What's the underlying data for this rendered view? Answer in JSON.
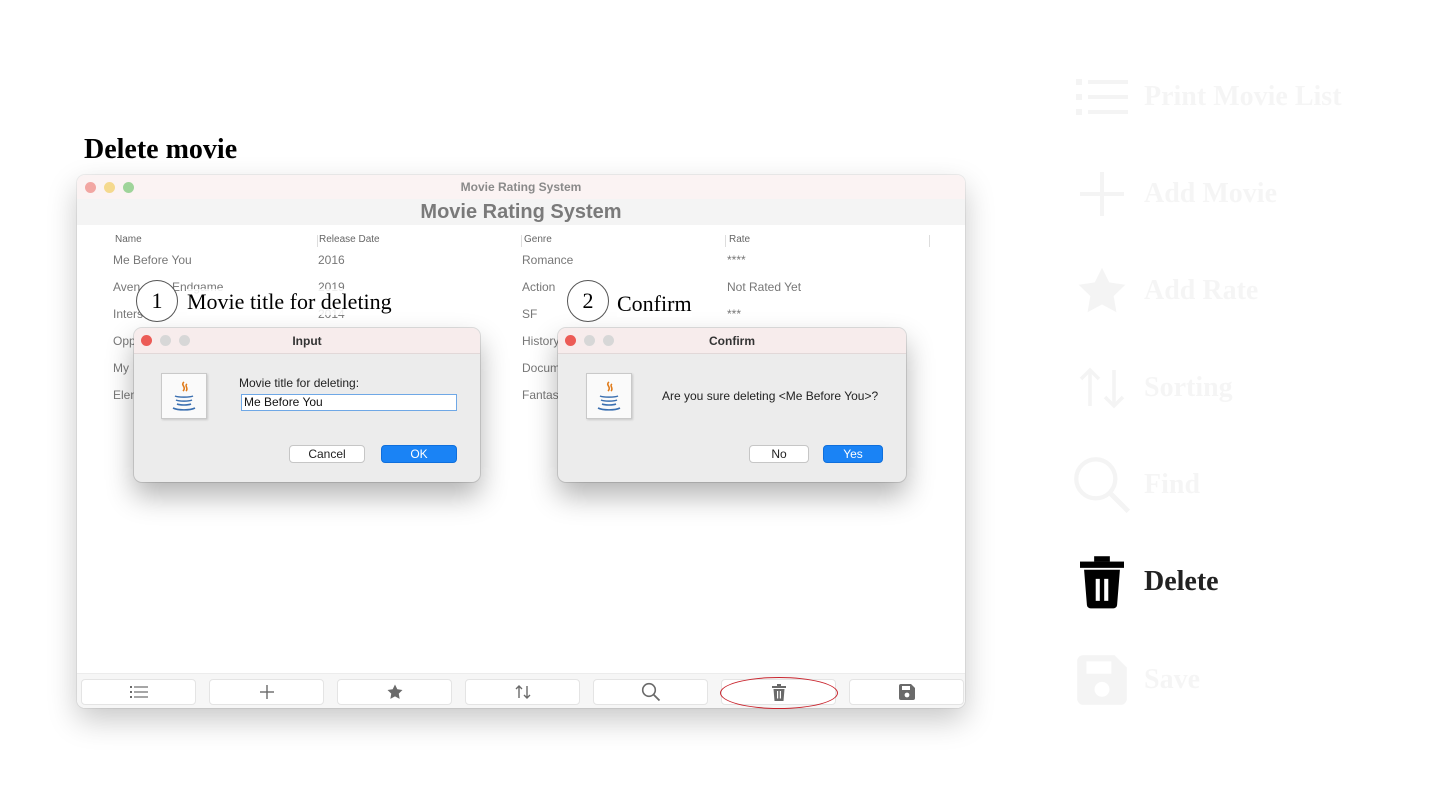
{
  "slide_title": "Delete movie",
  "window": {
    "title": "Movie Rating System",
    "app_title": "Movie Rating System",
    "columns": [
      "Name",
      "Release Date",
      "Genre",
      "Rate"
    ],
    "rows": [
      [
        "Me Before You",
        "2016",
        "Romance",
        "****"
      ],
      [
        "Aven",
        "2019",
        "Action",
        "Not Rated Yet"
      ],
      [
        "Inters",
        "2014",
        "SF",
        "***"
      ],
      [
        "Opp",
        "",
        "History",
        ""
      ],
      [
        "My",
        "",
        "Docum",
        ""
      ],
      [
        "Elen",
        "",
        "Fantas",
        ""
      ]
    ],
    "row2_name_tail": "Endgame",
    "toolbar": [
      "list-icon",
      "plus-icon",
      "star-icon",
      "sort-icon",
      "search-icon",
      "trash-icon",
      "save-icon"
    ]
  },
  "input_dialog": {
    "title": "Input",
    "prompt": "Movie title for deleting:",
    "value": "Me Before You",
    "cancel": "Cancel",
    "ok": "OK"
  },
  "confirm_dialog": {
    "title": "Confirm",
    "message": "Are you sure deleting <Me Before You>?",
    "no": "No",
    "yes": "Yes"
  },
  "steps": [
    {
      "number": "1",
      "label": "Movie title for deleting"
    },
    {
      "number": "2",
      "label": "Confirm"
    }
  ],
  "legend": [
    {
      "label": "Print Movie List",
      "icon": "list-icon",
      "active": false
    },
    {
      "label": "Add Movie",
      "icon": "plus-icon",
      "active": false
    },
    {
      "label": "Add Rate",
      "icon": "star-icon",
      "active": false
    },
    {
      "label": "Sorting",
      "icon": "sort-icon",
      "active": false
    },
    {
      "label": "Find",
      "icon": "search-icon",
      "active": false
    },
    {
      "label": "Delete",
      "icon": "trash-icon",
      "active": true
    },
    {
      "label": "Save",
      "icon": "save-icon",
      "active": false
    }
  ],
  "colors": {
    "highlight": "#c9252e",
    "primary_button": "#1a83f5"
  }
}
